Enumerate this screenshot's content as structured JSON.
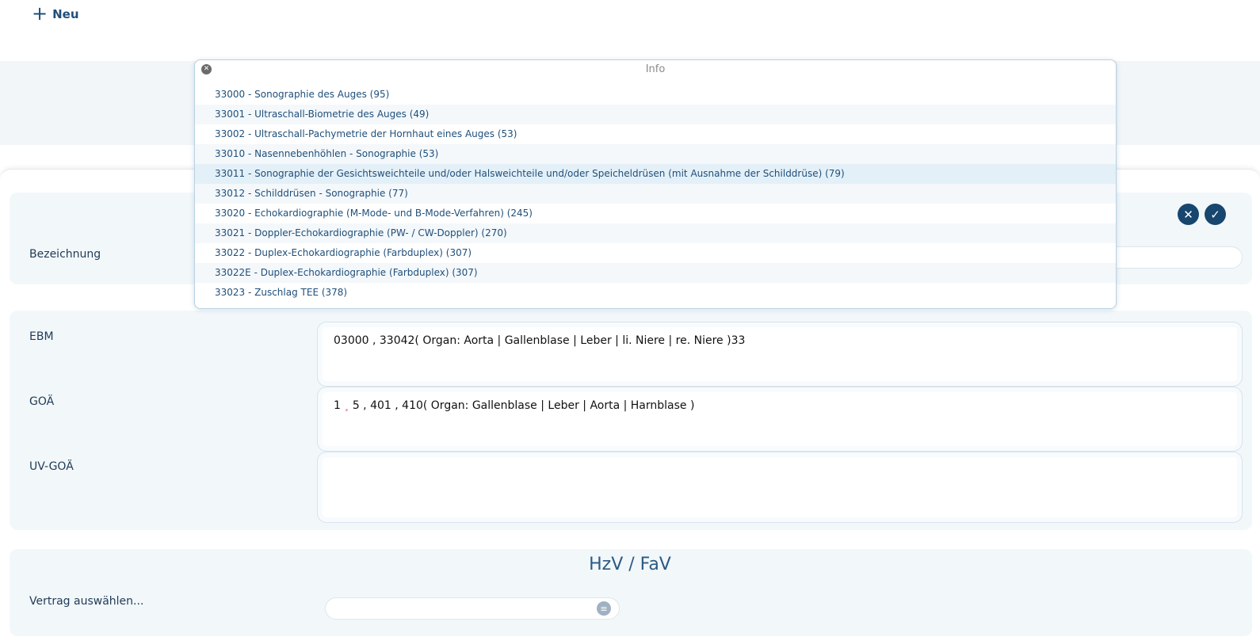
{
  "toolbar": {
    "new_label": "Neu",
    "new_icon": "plus-icon"
  },
  "popup": {
    "title": "Info",
    "items": [
      "33000 - Sonographie des Auges (95)",
      "33001 - Ultraschall-Biometrie des Auges (49)",
      "33002 - Ultraschall-Pachymetrie der Hornhaut eines Auges (53)",
      "33010 - Nasennebenhöhlen - Sonographie (53)",
      "33011 - Sonographie der Gesichtsweichteile und/oder Halsweichteile und/oder Speicheldrüsen (mit Ausnahme der Schilddrüse) (79)",
      "33012 - Schilddrüsen - Sonographie (77)",
      "33020 - Echokardiographie (M-Mode- und B-Mode-Verfahren) (245)",
      "33021 - Doppler-Echokardiographie (PW- / CW-Doppler) (270)",
      "33022 - Duplex-Echokardiographie (Farbduplex) (307)",
      "33022E - Duplex-Echokardiographie (Farbduplex) (307)",
      "33023 - Zuschlag TEE (378)"
    ],
    "highlighted_index": 4
  },
  "form": {
    "bezeichnung_label": "Bezeichnung",
    "ebm_label": "EBM",
    "ebm_value": "03000 , 33042( Organ: Aorta | Gallenblase | Leber | li. Niere | re. Niere )33",
    "goa_label": "GOÄ",
    "goa_value_a": "1",
    "goa_value_sep": "¸",
    "goa_value_b": "5 , 401 , 410( Organ: Gallenblase | Leber | Aorta | Harnblase )",
    "uvgoa_label": "UV-GOÄ",
    "uvgoa_value": ""
  },
  "hzv": {
    "title": "HzV / FaV",
    "vertrag_label": "Vertrag auswählen..."
  }
}
